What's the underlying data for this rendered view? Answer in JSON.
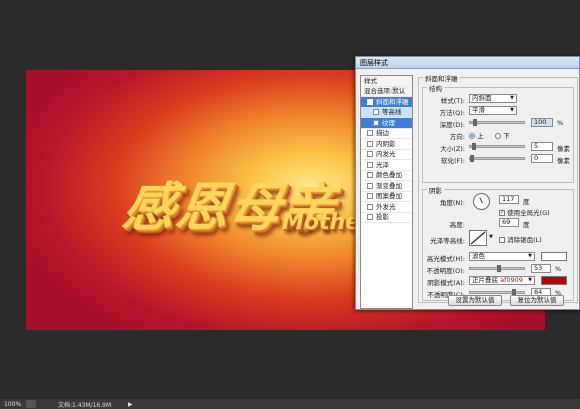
{
  "canvas": {
    "art_text": "感恩母亲",
    "art_text_en": "Mother"
  },
  "status": {
    "zoom": "100%",
    "doc": "文档:1.43M/16.9M",
    "arrow": "▶"
  },
  "dialog": {
    "title": "图层样式",
    "styles_header": "样式",
    "blend_options": "混合选项:默认",
    "style_items": [
      {
        "label": "斜面和浮雕",
        "checked": true
      },
      {
        "label": "等高线",
        "checked": false
      },
      {
        "label": "纹理",
        "checked": false
      },
      {
        "label": "描边",
        "checked": false
      },
      {
        "label": "内阴影",
        "checked": false
      },
      {
        "label": "内发光",
        "checked": false
      },
      {
        "label": "光泽",
        "checked": false
      },
      {
        "label": "颜色叠加",
        "checked": false
      },
      {
        "label": "渐变叠加",
        "checked": false
      },
      {
        "label": "图案叠加",
        "checked": false
      },
      {
        "label": "外发光",
        "checked": false
      },
      {
        "label": "投影",
        "checked": false
      }
    ],
    "section_title": "斜面和浮雕",
    "structure": {
      "title": "结构",
      "style_label": "样式(T):",
      "style_value": "内斜面",
      "method_label": "方法(Q):",
      "method_value": "平滑",
      "depth_label": "深度(D):",
      "depth_value": "100",
      "depth_unit": "%",
      "depth_level": 0.05,
      "direction_label": "方向:",
      "dir_up": "上",
      "dir_down": "下",
      "size_label": "大小(Z):",
      "size_value": "5",
      "size_unit": "像素",
      "size_level": 0.03,
      "soften_label": "软化(F):",
      "soften_value": "0",
      "soften_unit": "像素",
      "soften_level": 0.0
    },
    "shading": {
      "title": "阴影",
      "angle_label": "角度(N):",
      "angle_value": "117",
      "angle_unit": "度",
      "global_light": "使用全局光(G)",
      "altitude_label": "高度:",
      "altitude_value": "69",
      "altitude_unit": "度",
      "gloss_label": "光泽等高线:",
      "anti_alias": "消除锯齿(L)",
      "highlight_mode_label": "高光模式(H):",
      "highlight_mode_value": "滤色",
      "highlight_opacity_label": "不透明度(O):",
      "highlight_opacity_value": "53",
      "highlight_opacity_level": 0.53,
      "shadow_mode_label": "阴影模式(A):",
      "shadow_mode_value": "正片叠底",
      "shadow_color_hex": "af0909",
      "shadow_opacity_label": "不透明度(C):",
      "shadow_opacity_value": "84",
      "shadow_opacity_level": 0.84,
      "percent": "%"
    },
    "make_default": "设置为默认值",
    "reset_default": "复位为默认值"
  },
  "colors": {
    "highlight": "#ffffff",
    "shadow": "#af0909",
    "accent": "#3d7fd6"
  }
}
